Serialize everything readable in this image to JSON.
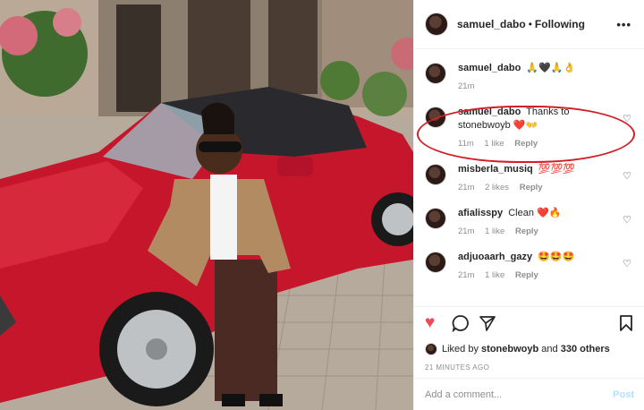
{
  "post": {
    "username": "samuel_dabo",
    "separator": "•",
    "follow_status": "Following",
    "more_icon": "ellipsis-icon"
  },
  "comments": [
    {
      "user": "samuel_dabo",
      "text": "🙏🖤🙏👌",
      "time": "21m",
      "likes": "",
      "reply": ""
    },
    {
      "user": "samuel_dabo",
      "text": "Thanks to stonebwoyb ❤️👐",
      "time": "11m",
      "likes": "1 like",
      "reply": "Reply"
    },
    {
      "user": "misberla_musiq",
      "text": "💯💯💯",
      "time": "21m",
      "likes": "2 likes",
      "reply": "Reply"
    },
    {
      "user": "afialisspy",
      "text": "Clean ❤️🔥",
      "time": "21m",
      "likes": "1 like",
      "reply": "Reply"
    },
    {
      "user": "adjuoaarh_gazy",
      "text": "🤩🤩🤩",
      "time": "21m",
      "likes": "1 like",
      "reply": "Reply"
    }
  ],
  "actions": {
    "like_icon": "heart-filled-icon",
    "comment_icon": "comment-icon",
    "share_icon": "paper-plane-icon",
    "save_icon": "bookmark-icon",
    "liked_by_prefix": "Liked by",
    "liked_by_user": "stonebwoyb",
    "liked_by_and": "and",
    "liked_by_others": "330 others",
    "timestamp": "21 MINUTES AGO"
  },
  "composer": {
    "placeholder": "Add a comment...",
    "post_label": "Post"
  },
  "colors": {
    "like_red": "#ed4956",
    "highlight_circle": "#d21f26",
    "post_disabled": "#b2dffc",
    "car_red": "#c5162b"
  }
}
